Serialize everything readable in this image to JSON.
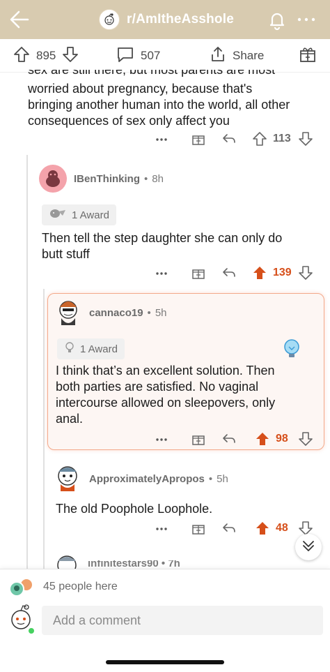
{
  "header": {
    "subreddit": "r/AmItheAsshole",
    "bg_color": "#d8cbb0"
  },
  "post_actions": {
    "upvotes": "895",
    "comments": "507",
    "share_label": "Share"
  },
  "comments": [
    {
      "id": "c0",
      "clipped_line": "sex are still there, but most parents are most",
      "text_lines": [
        "worried about pregnancy, because that's",
        "bringing another human into the world, all other",
        "consequences of sex only affect you"
      ],
      "score": "113",
      "upvoted": false
    },
    {
      "id": "c1",
      "username": "IBenThinking",
      "age": "8h",
      "award": "1 Award",
      "text_lines": [
        "Then tell the step daughter she can only do",
        "butt stuff"
      ],
      "score": "139",
      "upvoted": true
    },
    {
      "id": "c2",
      "username": "cannaco19",
      "age": "5h",
      "award": "1 Award",
      "text_lines": [
        "I think that’s an excellent solution. Then",
        "both parties are satisfied. No vaginal",
        "intercourse allowed on sleepovers, only",
        "anal."
      ],
      "score": "98",
      "upvoted": true,
      "highlighted": true
    },
    {
      "id": "c3",
      "username": "ApproximatelyApropos",
      "age": "5h",
      "text_lines": [
        "The old Poophole Loophole."
      ],
      "score": "48",
      "upvoted": true
    },
    {
      "id": "c4",
      "username": "infinitestars90",
      "age": "7h",
      "partial": true
    }
  ],
  "bottom": {
    "people_here": "45 people here",
    "comment_placeholder": "Add a comment"
  },
  "colors": {
    "upvote_orange": "#d64f1a",
    "highlight_border": "#f3a98a",
    "text": "#1c1c1c",
    "muted": "#7c7c7c"
  }
}
